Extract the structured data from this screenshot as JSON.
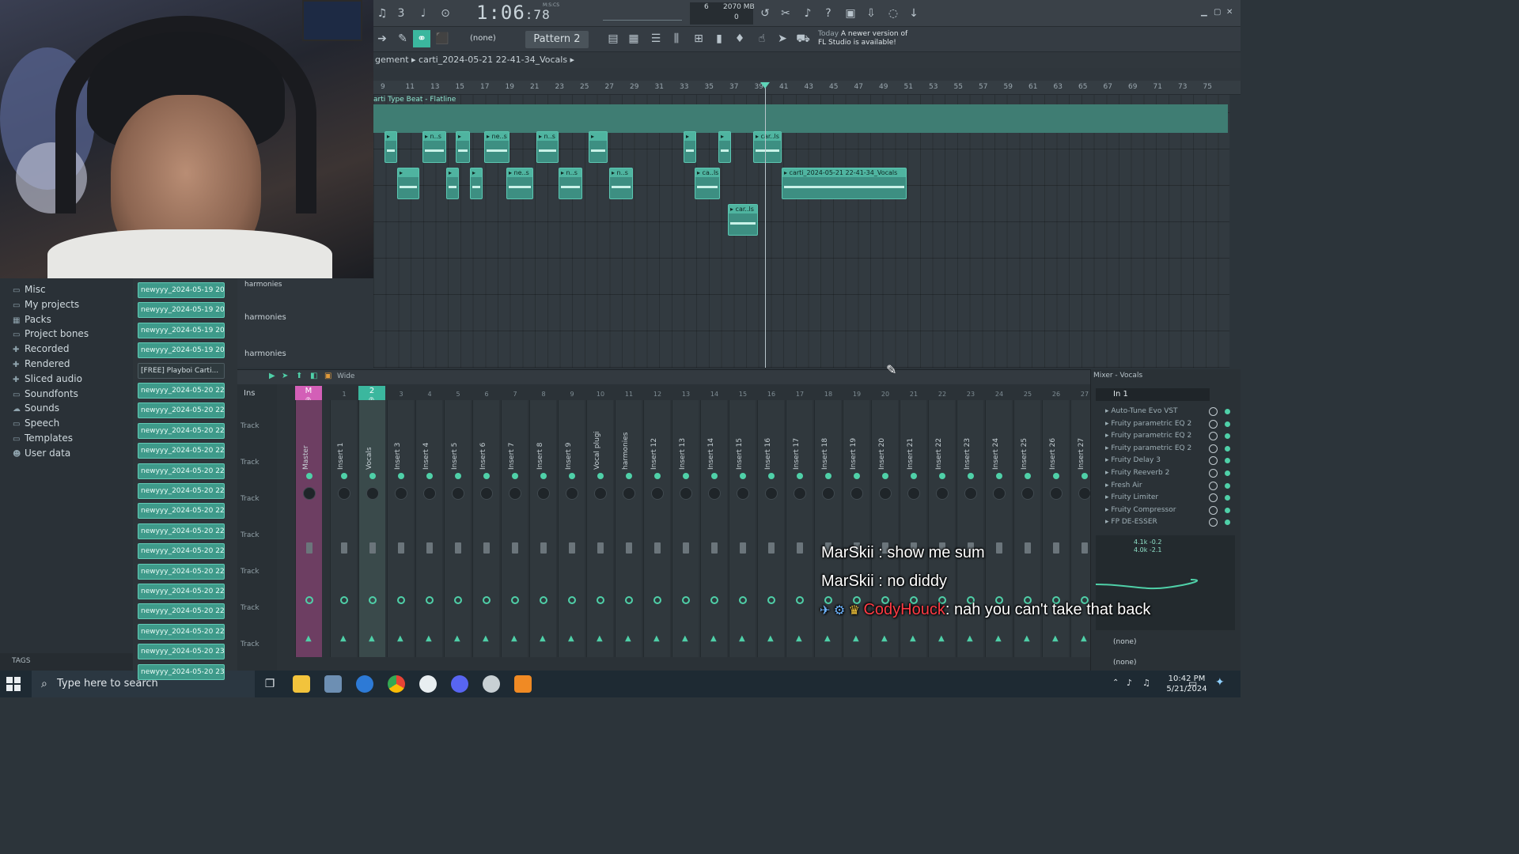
{
  "transport": {
    "time_main": "1:06",
    "time_sub": ":78",
    "time_label": "M:S:CS",
    "cpu_value": "6",
    "memory": "2070 MB",
    "voices": "0"
  },
  "toolbar2": {
    "pattern_none": "(none)",
    "pattern": "Pattern 2",
    "news_today": "Today",
    "news_line1": "A newer version of",
    "news_line2": "FL Studio is available!"
  },
  "playlist": {
    "title_prefix": "gement",
    "title": "carti_2024-05-21 22-41-34_Vocals",
    "beat_track_label": "arti Type Beat - Flatline",
    "ruler_numbers": [
      "9",
      "11",
      "13",
      "15",
      "17",
      "19",
      "21",
      "23",
      "25",
      "27",
      "29",
      "31",
      "33",
      "35",
      "37",
      "39",
      "41",
      "43",
      "45",
      "47",
      "49",
      "51",
      "53",
      "55",
      "57",
      "59",
      "61",
      "63",
      "65",
      "67",
      "69",
      "71",
      "73",
      "75"
    ],
    "clips_row1": [
      "",
      "n..s",
      "",
      "ne..s",
      "n..s",
      "",
      "",
      "",
      "car..ls"
    ],
    "clips_row2": [
      "",
      "",
      "",
      "ne..s",
      "n..s",
      "n..s",
      "ca..ls",
      "carti_2024-05-21 22-41-34_Vocals"
    ],
    "clips_row3": [
      "car..ls"
    ]
  },
  "browser": {
    "items": [
      {
        "icon": "folder-icon",
        "label": "Misc"
      },
      {
        "icon": "folder-icon",
        "label": "My projects"
      },
      {
        "icon": "packs-icon",
        "label": "Packs"
      },
      {
        "icon": "folder-icon",
        "label": "Project bones"
      },
      {
        "icon": "plus-icon",
        "label": "Recorded"
      },
      {
        "icon": "plus-icon",
        "label": "Rendered"
      },
      {
        "icon": "plus-icon",
        "label": "Sliced audio"
      },
      {
        "icon": "folder-icon",
        "label": "Soundfonts"
      },
      {
        "icon": "cloud-icon",
        "label": "Sounds"
      },
      {
        "icon": "folder-icon",
        "label": "Speech"
      },
      {
        "icon": "folder-icon",
        "label": "Templates"
      },
      {
        "icon": "user-icon",
        "label": "User data"
      }
    ],
    "tags_label": "TAGS"
  },
  "files": [
    "newyyy_2024-05-19 20-...",
    "newyyy_2024-05-19 20-...",
    "newyyy_2024-05-19 20-...",
    "newyyy_2024-05-19 20-...",
    "[FREE] Playboi Carti...",
    "newyyy_2024-05-20 22-...",
    "newyyy_2024-05-20 22-...",
    "newyyy_2024-05-20 22-...",
    "newyyy_2024-05-20 22-...",
    "newyyy_2024-05-20 22-...",
    "newyyy_2024-05-20 22-...",
    "newyyy_2024-05-20 22-...",
    "newyyy_2024-05-20 22-...",
    "newyyy_2024-05-20 22-...",
    "newyyy_2024-05-20 22-...",
    "newyyy_2024-05-20 22-...",
    "newyyy_2024-05-20 22-...",
    "newyyy_2024-05-20 22-...",
    "newyyy_2024-05-20 23-...",
    "newyyy_2024-05-20 23-..."
  ],
  "channel": {
    "header": "harmonies",
    "rows": [
      "harmonies",
      "harmonies"
    ]
  },
  "mixer": {
    "wide_label": "Wide",
    "ins_label": "Ins",
    "track_label": "Track",
    "master_label": "M",
    "vocals_num": "2",
    "strips": [
      {
        "num": "",
        "name": "Master"
      },
      {
        "num": "1",
        "name": "Insert 1"
      },
      {
        "num": "2",
        "name": "Vocals"
      },
      {
        "num": "3",
        "name": "Insert 3"
      },
      {
        "num": "4",
        "name": "Insert 4"
      },
      {
        "num": "5",
        "name": "Insert 5"
      },
      {
        "num": "6",
        "name": "Insert 6"
      },
      {
        "num": "7",
        "name": "Insert 7"
      },
      {
        "num": "8",
        "name": "Insert 8"
      },
      {
        "num": "9",
        "name": "Insert 9"
      },
      {
        "num": "10",
        "name": "Vocal plugins"
      },
      {
        "num": "11",
        "name": "harmonies"
      },
      {
        "num": "12",
        "name": "Insert 12"
      },
      {
        "num": "13",
        "name": "Insert 13"
      },
      {
        "num": "14",
        "name": "Insert 14"
      },
      {
        "num": "15",
        "name": "Insert 15"
      },
      {
        "num": "16",
        "name": "Insert 16"
      },
      {
        "num": "17",
        "name": "Insert 17"
      },
      {
        "num": "18",
        "name": "Insert 18"
      },
      {
        "num": "19",
        "name": "Insert 19"
      },
      {
        "num": "20",
        "name": "Insert 20"
      },
      {
        "num": "21",
        "name": "Insert 21"
      },
      {
        "num": "22",
        "name": "Insert 22"
      },
      {
        "num": "23",
        "name": "Insert 23"
      },
      {
        "num": "24",
        "name": "Insert 24"
      },
      {
        "num": "25",
        "name": "Insert 25"
      },
      {
        "num": "26",
        "name": "Insert 26"
      },
      {
        "num": "27",
        "name": "Insert 27"
      }
    ]
  },
  "insert_panel": {
    "title": "Mixer - Vocals",
    "input": "In 1",
    "slots": [
      "Auto-Tune Evo VST",
      "Fruity parametric EQ 2",
      "Fruity parametric EQ 2",
      "Fruity parametric EQ 2",
      "Fruity Delay 3",
      "Fruity Reeverb 2",
      "Fresh Air",
      "Fruity Limiter",
      "Fruity Compressor",
      "FP DE-ESSER"
    ],
    "eq_readout_1": "4.1k -0.2",
    "eq_readout_2": "4.0k -2.1",
    "send1": "(none)",
    "send2": "(none)"
  },
  "chat": [
    {
      "user": "MarSkii",
      "message": " : show me sum"
    },
    {
      "user": "MarSkii",
      "message": " : no diddy"
    },
    {
      "user": "CodyHouck",
      "message": ": nah you can't take that back"
    }
  ],
  "taskbar": {
    "search_placeholder": "Type here to search",
    "time": "10:42 PM",
    "date": "5/21/2024"
  },
  "colors": {
    "accent": "#3bb79e",
    "master": "#d35fb7",
    "chat_highlight": "#ff3b44"
  }
}
